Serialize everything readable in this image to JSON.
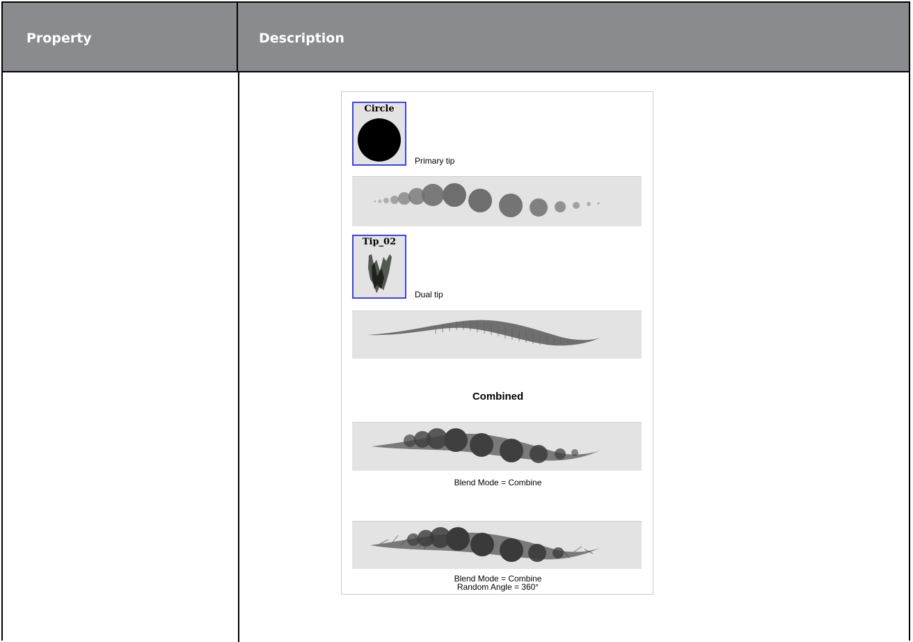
{
  "table": {
    "header": {
      "property": "Property",
      "description": "Description"
    }
  },
  "figure": {
    "primary_tip_name": "Circle",
    "primary_tip_caption": "Primary tip",
    "dual_tip_name": "Tip_02",
    "dual_tip_caption": "Dual tip",
    "combined_heading": "Combined",
    "caption_1": "Blend Mode = Combine",
    "caption_2_line1": "Blend Mode = Combine",
    "caption_2_line2": "Random Angle = 360°"
  },
  "colors": {
    "header_bg": "#8a8b8f",
    "tip_border": "#3f3fe6",
    "panel_bg": "#e3e3e3"
  }
}
